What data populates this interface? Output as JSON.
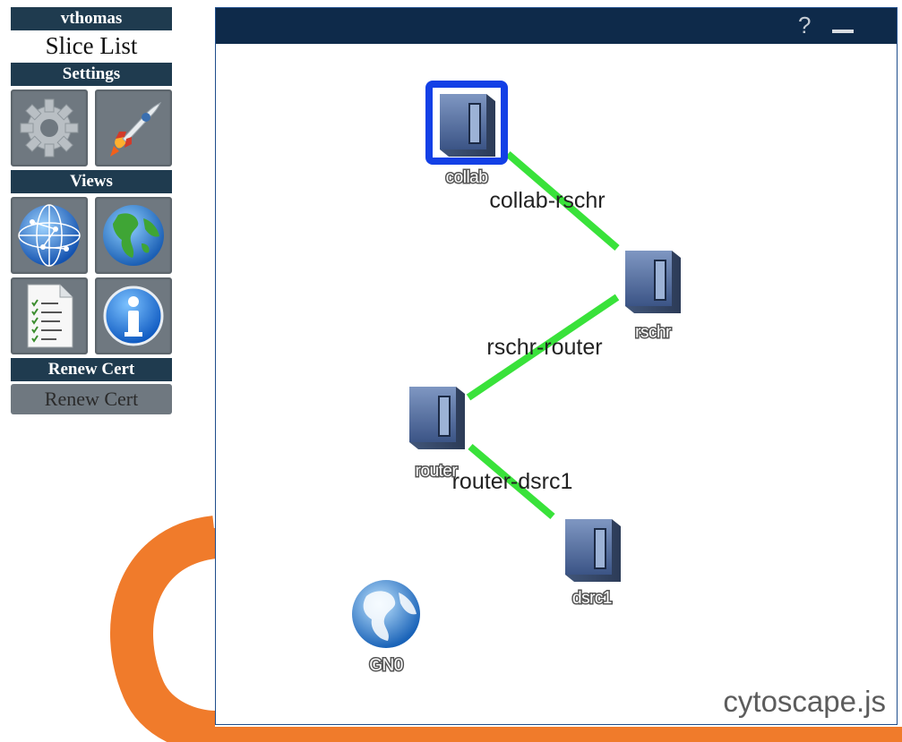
{
  "user": {
    "name": "vthomas"
  },
  "sidebar": {
    "slice_list_label": "Slice List",
    "settings_header": "Settings",
    "views_header": "Views",
    "renew_header": "Renew Cert",
    "renew_button": "Renew Cert"
  },
  "panel": {
    "help_label": "?",
    "watermark": "cytoscape.js"
  },
  "graph": {
    "nodes": [
      {
        "id": "collab",
        "label": "collab",
        "selected": true
      },
      {
        "id": "rschr",
        "label": "rschr"
      },
      {
        "id": "router",
        "label": "router"
      },
      {
        "id": "dsrc1",
        "label": "dsrc1"
      },
      {
        "id": "GN0",
        "label": "GN0",
        "icon": "globe-icon"
      }
    ],
    "edges": [
      {
        "id": "collab-rschr",
        "label": "collab-rschr",
        "source": "collab",
        "target": "rschr"
      },
      {
        "id": "rschr-router",
        "label": "rschr-router",
        "source": "rschr",
        "target": "router"
      },
      {
        "id": "router-dsrc1",
        "label": "router-dsrc1",
        "source": "router",
        "target": "dsrc1"
      }
    ],
    "colors": {
      "edge": "#39e23a",
      "selected_border": "#1340e6"
    }
  },
  "colors": {
    "header_bg": "#1f3b4f",
    "panel_bar": "#0e2a4a",
    "logo_orange": "#f07b2b"
  }
}
